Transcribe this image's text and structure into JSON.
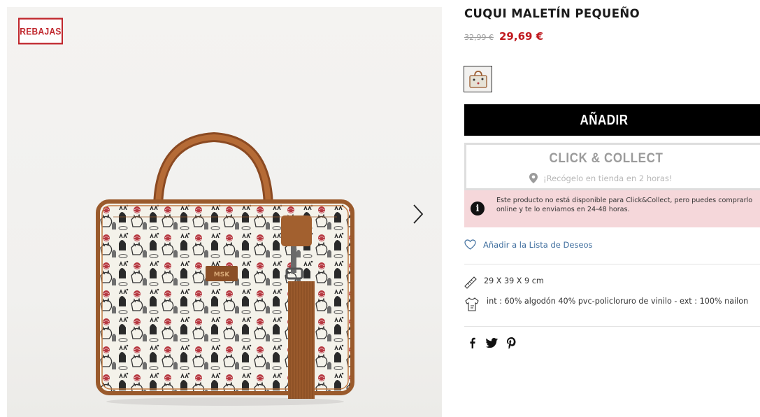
{
  "product": {
    "badge": "REBAJAS",
    "title": "CUQUI MALETÍN PEQUEÑO",
    "old_price": "32,99 €",
    "price": "29,69 €",
    "bag_logo": "MSK"
  },
  "actions": {
    "add_label": "AÑADIR",
    "click_collect_title": "CLICK & COLLECT",
    "click_collect_sub": "¡Recógelo en tienda en 2 horas!",
    "notice": "Este producto no está disponible para Click&Collect, pero puedes comprarlo online y te lo enviamos en 24-48 horas.",
    "wishlist": "Añadir a la Lista de Deseos"
  },
  "specs": {
    "dimensions": "29 X 39 X 9 cm",
    "composition": "int : 60% algodón 40% pvc-policloruro de vinilo - ext : 100% nailon"
  },
  "icons": {
    "gallery_next": "chevron-right-icon",
    "location": "map-pin-icon",
    "info": "info-icon",
    "wishlist": "heart-icon",
    "dimensions": "ruler-icon",
    "composition": "fabric-icon",
    "social": [
      "facebook-icon",
      "twitter-icon",
      "pinterest-icon"
    ]
  },
  "colors": {
    "sale": "#c0272d",
    "price": "#c0191f",
    "add_button": "#000000",
    "notice_bg": "#f5d7da",
    "wishlist": "#3f6e9e"
  }
}
